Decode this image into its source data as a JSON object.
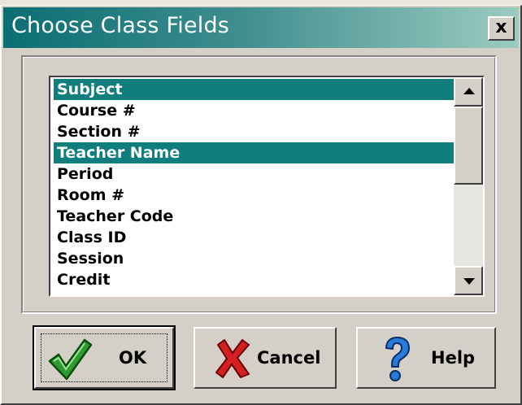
{
  "window": {
    "title": "Choose Class Fields",
    "close_label": "x"
  },
  "field_list": {
    "items": [
      {
        "label": "Subject",
        "selected": true
      },
      {
        "label": "Course #",
        "selected": false
      },
      {
        "label": "Section #",
        "selected": false
      },
      {
        "label": "Teacher Name",
        "selected": true
      },
      {
        "label": "Period",
        "selected": false
      },
      {
        "label": "Room #",
        "selected": false
      },
      {
        "label": "Teacher Code",
        "selected": false
      },
      {
        "label": "Class ID",
        "selected": false
      },
      {
        "label": "Session",
        "selected": false
      },
      {
        "label": "Credit",
        "selected": false
      }
    ],
    "selection_color": "#0f7e7c"
  },
  "buttons": {
    "ok_label": "OK",
    "ok_icon": "checkmark-icon",
    "cancel_label": "Cancel",
    "cancel_icon": "red-x-icon",
    "help_label": "Help",
    "help_icon": "question-mark-icon"
  },
  "colors": {
    "title_gradient_start": "#0a6e73",
    "title_gradient_end": "#9ccbc0",
    "dialog_face": "#d4d0c8"
  }
}
